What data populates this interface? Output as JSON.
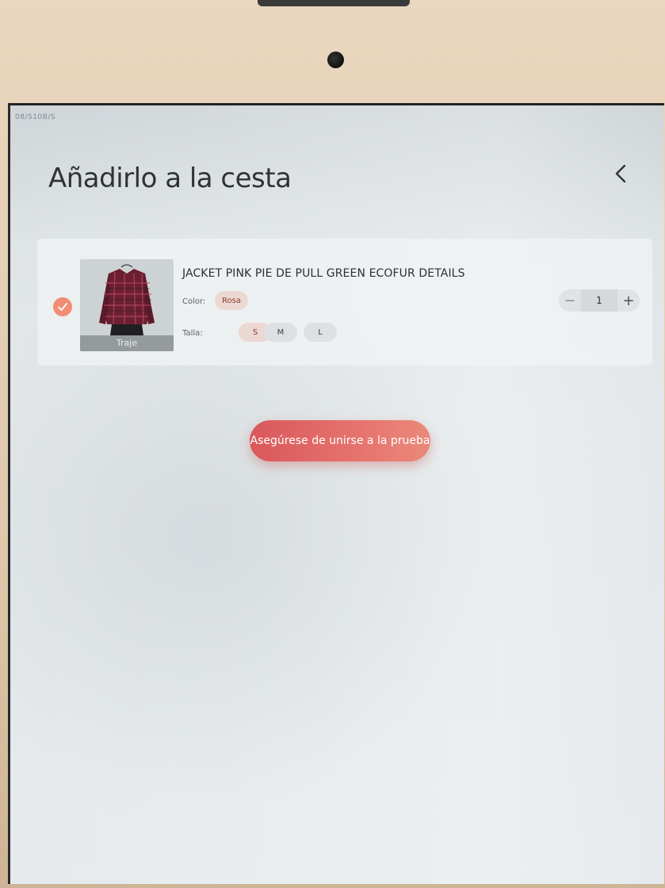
{
  "status": {
    "text": "08/S10B/S"
  },
  "header": {
    "title": "Añadirlo a la cesta",
    "back_icon": "chevron-left-icon"
  },
  "cart_item": {
    "selected": true,
    "image_caption": "Traje",
    "name": "JACKET PINK PIE DE PULL GREEN ECOFUR DETAILS",
    "color_label": "Color:",
    "color_value": "Rosa",
    "size_label": "Talla:",
    "sizes": [
      "S",
      "M",
      "L"
    ],
    "selected_size": "S",
    "quantity": {
      "minus": "−",
      "value": "1",
      "plus": "+"
    }
  },
  "cta": {
    "label": "Asegúrese de unirse a la prueba"
  },
  "colors": {
    "accent": "#e0625f",
    "check": "#f08d73",
    "selected_chip": "#ecd8d3"
  }
}
